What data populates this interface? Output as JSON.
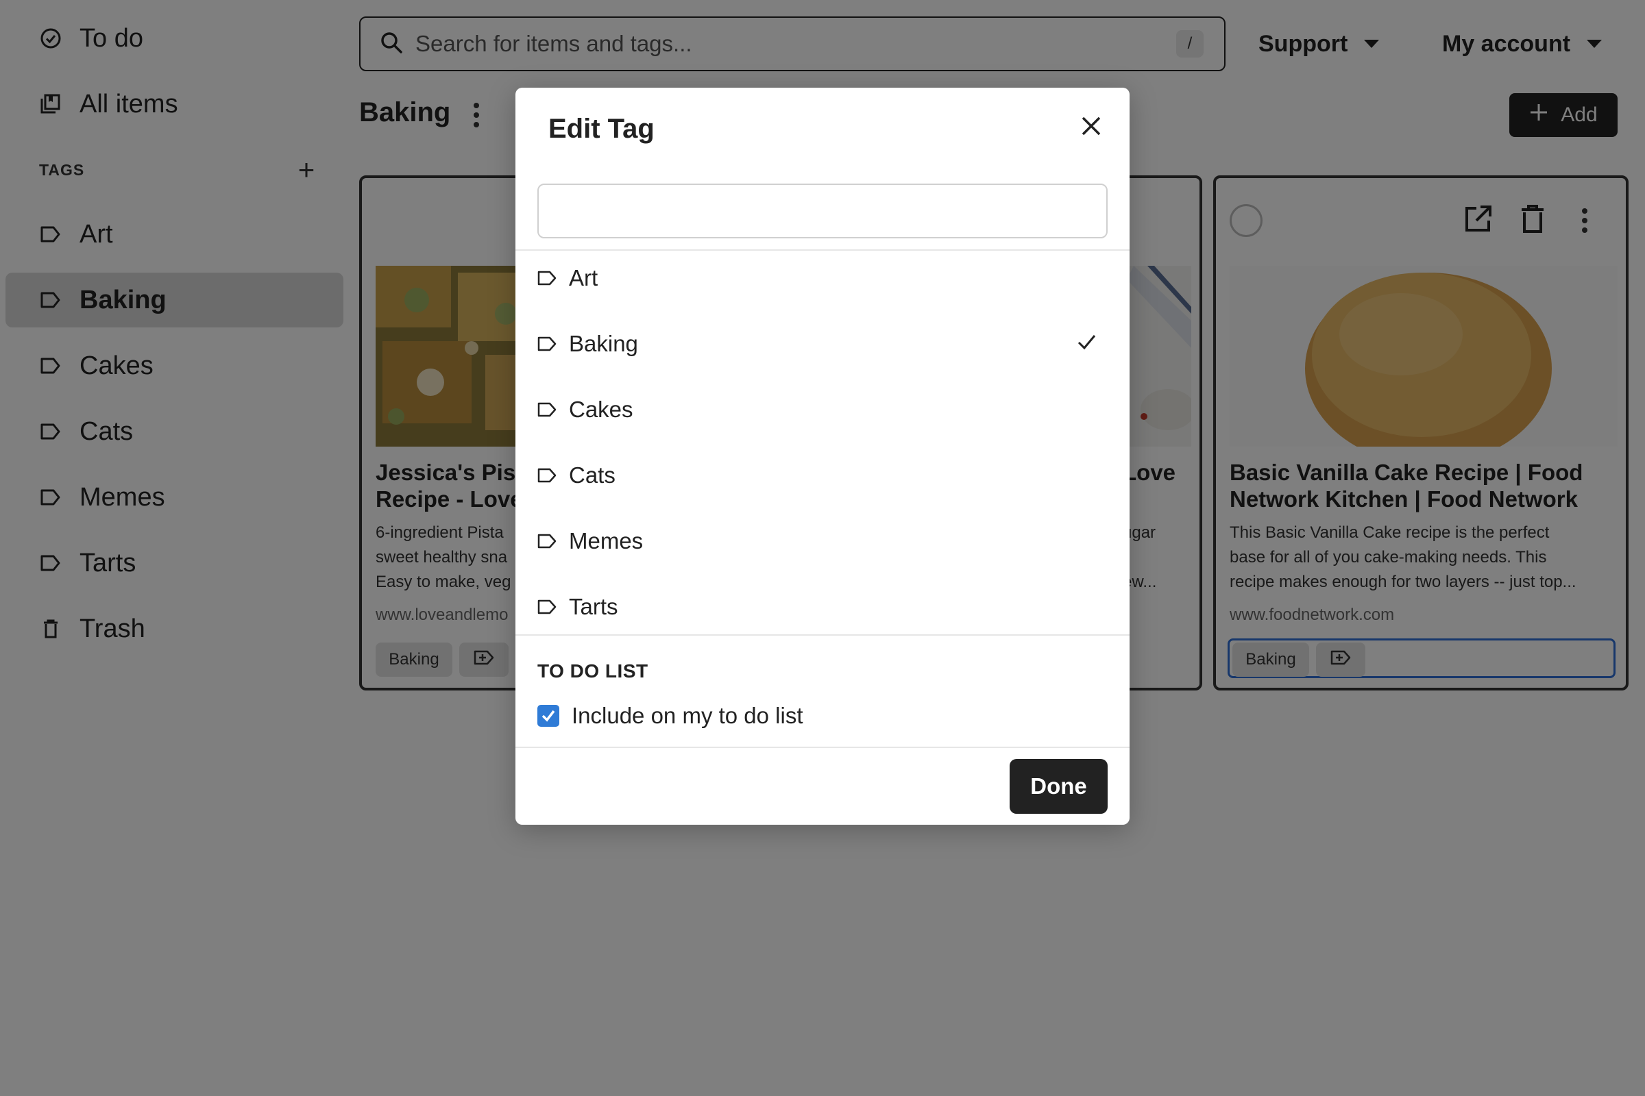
{
  "sidebar": {
    "todo_label": "To do",
    "all_items_label": "All items",
    "tags_header": "TAGS",
    "tags": [
      "Art",
      "Baking",
      "Cakes",
      "Cats",
      "Memes",
      "Tarts"
    ],
    "active_tag": "Baking",
    "trash_label": "Trash"
  },
  "topbar": {
    "search_placeholder": "Search for items and tags...",
    "search_shortcut": "/",
    "support_label": "Support",
    "account_label": "My account"
  },
  "page": {
    "title": "Baking",
    "add_label": "Add"
  },
  "cards": [
    {
      "title_line1": "Jessica's Pist",
      "title_line2": "Recipe - Love",
      "desc_line1": "6-ingredient Pista",
      "desc_line2": "sweet healthy sna",
      "desc_line3": "Easy to make, veg",
      "url": "www.loveandlemo",
      "tag": "Baking"
    },
    {
      "title_line1": "Love",
      "desc_line1": "ugar",
      "desc_line3": "ew..."
    },
    {
      "title_line1": "Basic Vanilla Cake Recipe | Food",
      "title_line2": "Network Kitchen | Food Network",
      "desc_line1": "This Basic Vanilla Cake recipe is the perfect",
      "desc_line2": "base for all of you cake-making needs. This",
      "desc_line3": "recipe makes enough for two layers -- just top...",
      "url": "www.foodnetwork.com",
      "tag": "Baking"
    }
  ],
  "modal": {
    "title": "Edit Tag",
    "input_value": "",
    "tags": [
      {
        "label": "Art",
        "checked": false
      },
      {
        "label": "Baking",
        "checked": true
      },
      {
        "label": "Cakes",
        "checked": false
      },
      {
        "label": "Cats",
        "checked": false
      },
      {
        "label": "Memes",
        "checked": false
      },
      {
        "label": "Tarts",
        "checked": false
      }
    ],
    "todo_section_label": "TO DO LIST",
    "todo_checkbox_label": "Include on my to do list",
    "todo_checked": true,
    "done_label": "Done"
  },
  "colors": {
    "accent_blue": "#2f7bd6",
    "dark": "#222222",
    "overlay": "rgba(0,0,0,0.5)"
  }
}
